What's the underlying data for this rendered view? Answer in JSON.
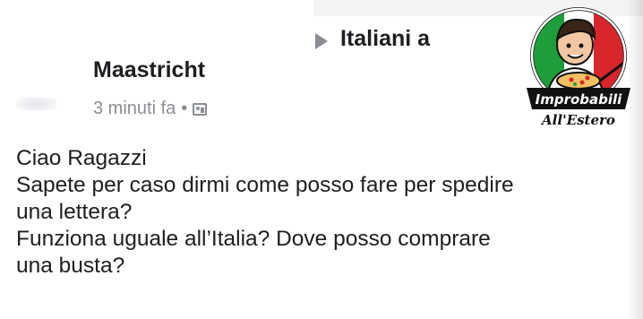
{
  "header": {
    "group_line1": "Italiani a",
    "group_line2": "Maastricht"
  },
  "meta": {
    "time": "3 minuti fa",
    "separator": "•",
    "audience_icon": "group-audience-icon"
  },
  "post": {
    "lines": [
      "Ciao Ragazzi",
      "Sapete per caso dirmi come posso fare per spedire",
      "una lettera?",
      "Funziona uguale all’Italia? Dove posso comprare",
      "una busta?"
    ]
  },
  "watermark": {
    "line1": "Improbabili",
    "line2": "All'Estero",
    "colors": {
      "green": "#1e9e3a",
      "white": "#ffffff",
      "red": "#d8262c",
      "black": "#111111"
    }
  }
}
